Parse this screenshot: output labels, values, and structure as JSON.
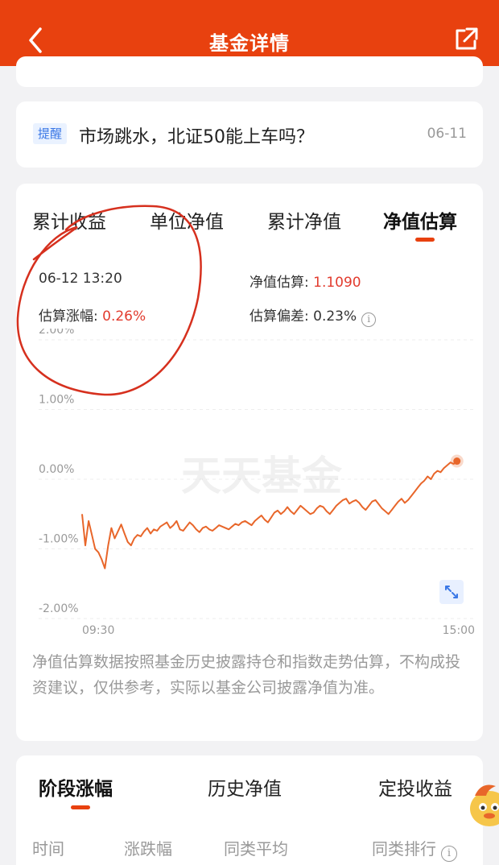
{
  "header": {
    "title": "基金详情",
    "back_icon": "chevron-left-icon",
    "share_icon": "share-external-icon"
  },
  "news": {
    "tag": "提醒",
    "title": "市场跳水，北证50能上车吗？",
    "date": "06-11"
  },
  "chart_section": {
    "tabs": [
      {
        "label": "累计收益",
        "active": false
      },
      {
        "label": "单位净值",
        "active": false
      },
      {
        "label": "累计净值",
        "active": false
      },
      {
        "label": "净值估算",
        "active": true
      }
    ],
    "datetime": "06-12 13:20",
    "nav_estimate_label": "净值估算: ",
    "nav_estimate_value": "1.1090",
    "est_change_label": "估算涨幅: ",
    "est_change_value": "0.26%",
    "est_deviation_label": "估算偏差: ",
    "est_deviation_value": "0.23%",
    "watermark": "天天基金",
    "note": "净值估算数据按照基金历史披露持仓和指数走势估算，不构成投资建议，仅供参考，实际以基金公司披露净值为准。"
  },
  "chart_data": {
    "type": "line",
    "title": "",
    "xlabel": "",
    "ylabel": "",
    "y_ticks": [
      "2.00%",
      "1.00%",
      "0.00%",
      "-1.00%",
      "-2.00%"
    ],
    "x_ticks": [
      "09:30",
      "15:00"
    ],
    "ylim": [
      -2.0,
      2.0
    ],
    "xlim": [
      0,
      240
    ],
    "grid": true,
    "line_color": "#e8662a",
    "series": [
      {
        "x": [
          0,
          2,
          4,
          6,
          8,
          10,
          12,
          14,
          16,
          18,
          20,
          22,
          24,
          26,
          28,
          30,
          32,
          34,
          36,
          38,
          40,
          42,
          44,
          46,
          48,
          50,
          52,
          54,
          56,
          58,
          60,
          62,
          64,
          66,
          68,
          70,
          72,
          74,
          76,
          78,
          80,
          82,
          84,
          86,
          88,
          90,
          92,
          94,
          96,
          98,
          100,
          102,
          104,
          106,
          108,
          110,
          112,
          114,
          116,
          118,
          120,
          122,
          124,
          126,
          128,
          130,
          132,
          134,
          136,
          138,
          140,
          142,
          144,
          146,
          148,
          150,
          152,
          154,
          156,
          158,
          160,
          162,
          164,
          166,
          168,
          170,
          172,
          174,
          176,
          178,
          180,
          182,
          184,
          186,
          188,
          190,
          192,
          194,
          196,
          198,
          200,
          202,
          204,
          206,
          208,
          210,
          212,
          214,
          216,
          218,
          220,
          222,
          224,
          226,
          228,
          230
        ],
        "values": [
          -0.5,
          -0.95,
          -0.6,
          -0.8,
          -1.0,
          -1.05,
          -1.15,
          -1.28,
          -0.95,
          -0.7,
          -0.85,
          -0.75,
          -0.65,
          -0.78,
          -0.9,
          -0.95,
          -0.85,
          -0.8,
          -0.82,
          -0.75,
          -0.7,
          -0.78,
          -0.72,
          -0.74,
          -0.68,
          -0.65,
          -0.62,
          -0.7,
          -0.66,
          -0.6,
          -0.72,
          -0.74,
          -0.68,
          -0.62,
          -0.66,
          -0.72,
          -0.76,
          -0.7,
          -0.68,
          -0.72,
          -0.74,
          -0.7,
          -0.66,
          -0.68,
          -0.7,
          -0.72,
          -0.68,
          -0.64,
          -0.66,
          -0.62,
          -0.6,
          -0.63,
          -0.66,
          -0.6,
          -0.56,
          -0.52,
          -0.58,
          -0.62,
          -0.55,
          -0.48,
          -0.45,
          -0.5,
          -0.46,
          -0.4,
          -0.46,
          -0.5,
          -0.44,
          -0.38,
          -0.42,
          -0.46,
          -0.5,
          -0.48,
          -0.42,
          -0.38,
          -0.4,
          -0.46,
          -0.5,
          -0.44,
          -0.38,
          -0.34,
          -0.3,
          -0.28,
          -0.35,
          -0.32,
          -0.3,
          -0.34,
          -0.4,
          -0.44,
          -0.38,
          -0.32,
          -0.3,
          -0.36,
          -0.42,
          -0.46,
          -0.5,
          -0.44,
          -0.38,
          -0.32,
          -0.28,
          -0.34,
          -0.3,
          -0.24,
          -0.18,
          -0.12,
          -0.06,
          -0.02,
          0.04,
          0.0,
          0.08,
          0.12,
          0.1,
          0.16,
          0.2,
          0.24,
          0.22,
          0.26
        ]
      }
    ]
  },
  "bottom_section": {
    "tabs": [
      {
        "label": "阶段涨幅",
        "active": true
      },
      {
        "label": "历史净值",
        "active": false
      },
      {
        "label": "定投收益",
        "active": false
      }
    ],
    "columns": [
      "时间",
      "涨跌幅",
      "同类平均",
      "同类排行"
    ]
  },
  "colors": {
    "brand": "#e8410f",
    "up": "#e23b2e",
    "muted": "#999999",
    "annotation": "#d6301e"
  }
}
